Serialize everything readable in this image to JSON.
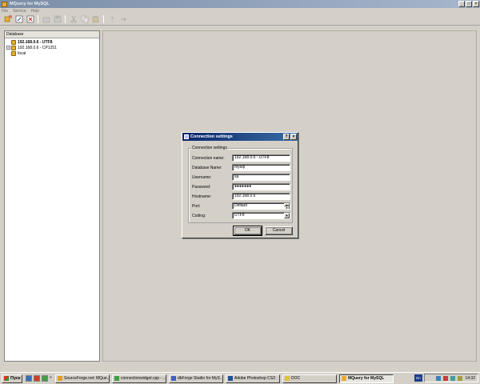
{
  "window": {
    "title": "MQuery for MySQL",
    "minimize": "_",
    "maximize": "□",
    "close": "×"
  },
  "menu": {
    "items": [
      "File",
      "Service",
      "Help"
    ]
  },
  "sidebar": {
    "header": "Database",
    "items": [
      {
        "label": "192.168.0.6 - UTF8",
        "selected": true,
        "expander": ""
      },
      {
        "label": "192.168.0.6 - CP1251",
        "selected": false,
        "expander": "+"
      },
      {
        "label": "local",
        "selected": false,
        "expander": ""
      }
    ]
  },
  "dialog": {
    "title": "Connection settings",
    "help": "?",
    "close": "×",
    "group_title": "Connection settings",
    "fields": {
      "connection_name": {
        "label": "Connection name:",
        "value": "192.168.0.6 - UTF8"
      },
      "database_name": {
        "label": "Database Name:",
        "value": "mysql"
      },
      "username": {
        "label": "Username:",
        "value": "sa"
      },
      "password": {
        "label": "Password:",
        "value": "●●●●●●●"
      },
      "hostname": {
        "label": "Hostname:",
        "value": "192.168.0.6"
      },
      "port": {
        "label": "Port:",
        "value": "Default"
      },
      "coding": {
        "label": "Coding:",
        "value": "UTF8"
      }
    },
    "ok_label": "OK",
    "cancel_label": "Cancel"
  },
  "taskbar": {
    "start_label": "Пуск",
    "tasks": [
      {
        "label": "SourceForge.net: MQue...",
        "color": "#e0a020"
      },
      {
        "label": "connectionwidget.cpp - ...",
        "color": "#40a040"
      },
      {
        "label": "dbForge Studio for MyS...",
        "color": "#4060c0"
      },
      {
        "label": "Adobe Photoshop CS3",
        "color": "#2050a0"
      },
      {
        "label": "DOC",
        "color": "#e0c040"
      },
      {
        "label": "MQuery for MySQL",
        "color": "#e8a838",
        "active": true
      }
    ],
    "lang": "En",
    "clock": "14:32"
  }
}
